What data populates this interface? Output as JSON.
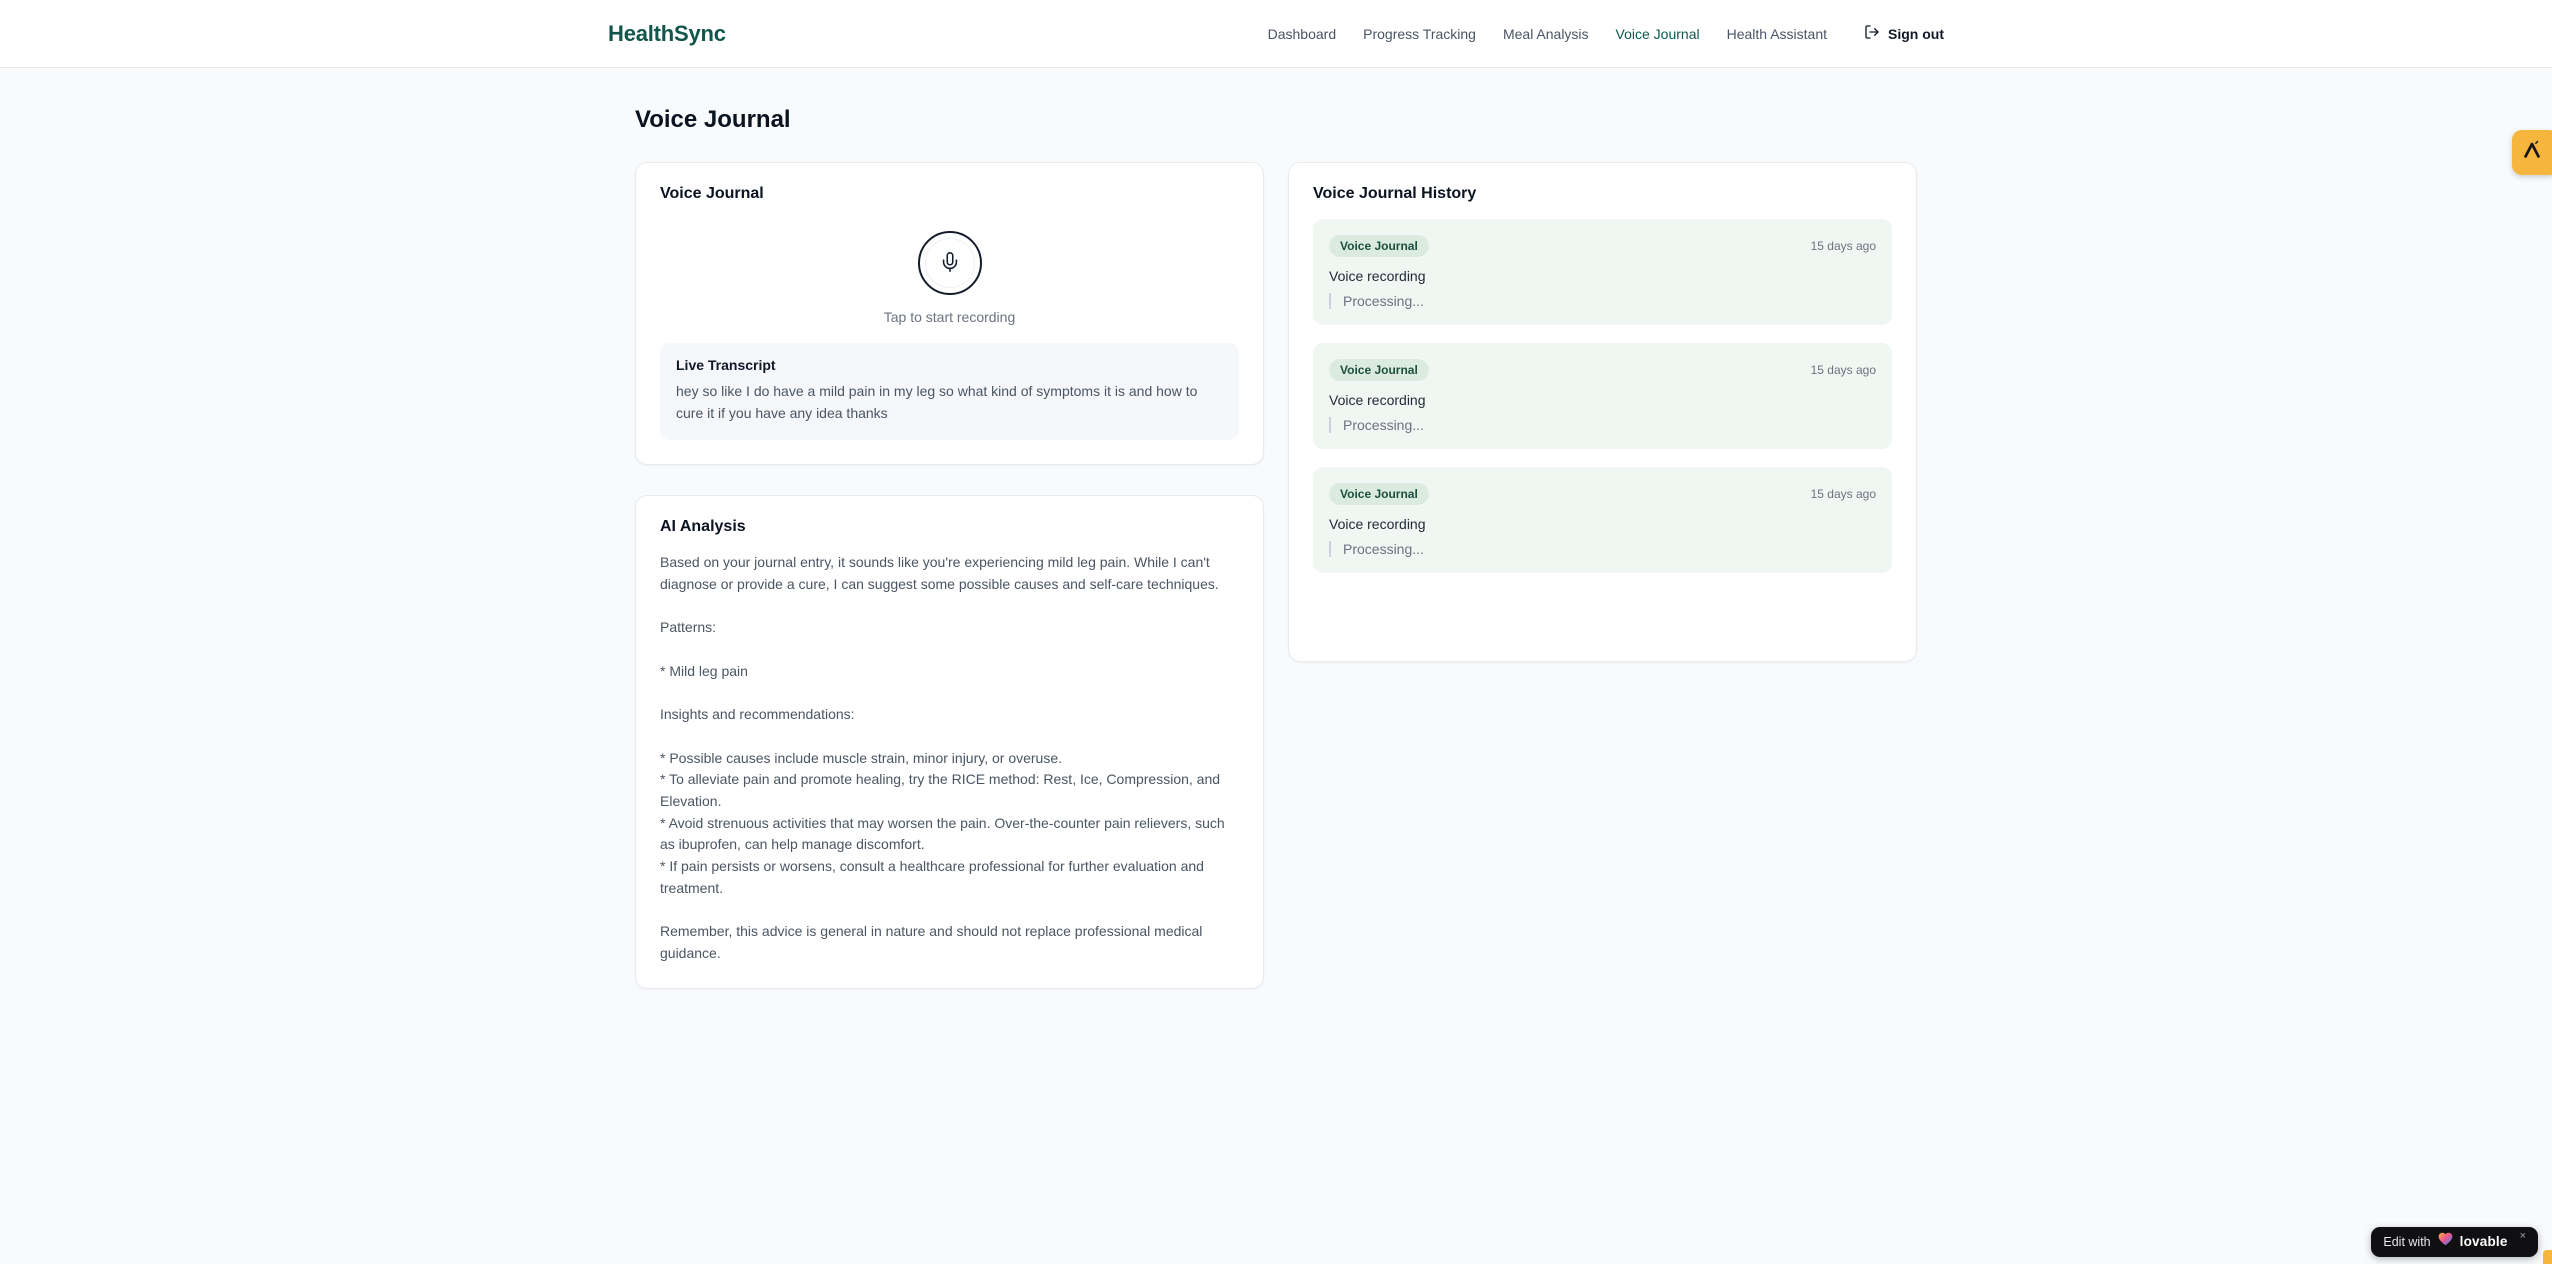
{
  "brand": {
    "name": "HealthSync"
  },
  "nav": {
    "items": [
      {
        "label": "Dashboard"
      },
      {
        "label": "Progress Tracking"
      },
      {
        "label": "Meal Analysis"
      },
      {
        "label": "Voice Journal",
        "active": true
      },
      {
        "label": "Health Assistant"
      }
    ],
    "sign_out": "Sign out"
  },
  "page": {
    "title": "Voice Journal"
  },
  "recorder": {
    "card_title": "Voice Journal",
    "tap_hint": "Tap to start recording",
    "live_transcript_title": "Live Transcript",
    "live_transcript_text": "hey so like I do have a mild pain in my leg so what kind of symptoms it is and how to cure it if you have any idea thanks"
  },
  "analysis": {
    "card_title": "AI Analysis",
    "body": "Based on your journal entry, it sounds like you're experiencing mild leg pain. While I can't diagnose or provide a cure, I can suggest some possible causes and self-care techniques.\n\nPatterns:\n\n* Mild leg pain\n\nInsights and recommendations:\n\n* Possible causes include muscle strain, minor injury, or overuse.\n* To alleviate pain and promote healing, try the RICE method: Rest, Ice, Compression, and Elevation.\n* Avoid strenuous activities that may worsen the pain. Over-the-counter pain relievers, such as ibuprofen, can help manage discomfort.\n* If pain persists or worsens, consult a healthcare professional for further evaluation and treatment.\n\nRemember, this advice is general in nature and should not replace professional medical guidance."
  },
  "history": {
    "card_title": "Voice Journal History",
    "entries": [
      {
        "badge": "Voice Journal",
        "time": "15 days ago",
        "title": "Voice recording",
        "status": "Processing..."
      },
      {
        "badge": "Voice Journal",
        "time": "15 days ago",
        "title": "Voice recording",
        "status": "Processing..."
      },
      {
        "badge": "Voice Journal",
        "time": "15 days ago",
        "title": "Voice recording",
        "status": "Processing..."
      }
    ]
  },
  "lovable": {
    "edit_prefix": "Edit with",
    "brand": "lovable",
    "close": "×"
  },
  "colors": {
    "brand_green": "#11564a",
    "active_nav": "#0d5a4e",
    "history_entry_bg": "#f0f7f2",
    "badge_bg": "#dcebe0",
    "badge_text": "#1c4f40",
    "lovable_amber": "#f6b53c",
    "page_bg": "#f8fafc"
  }
}
